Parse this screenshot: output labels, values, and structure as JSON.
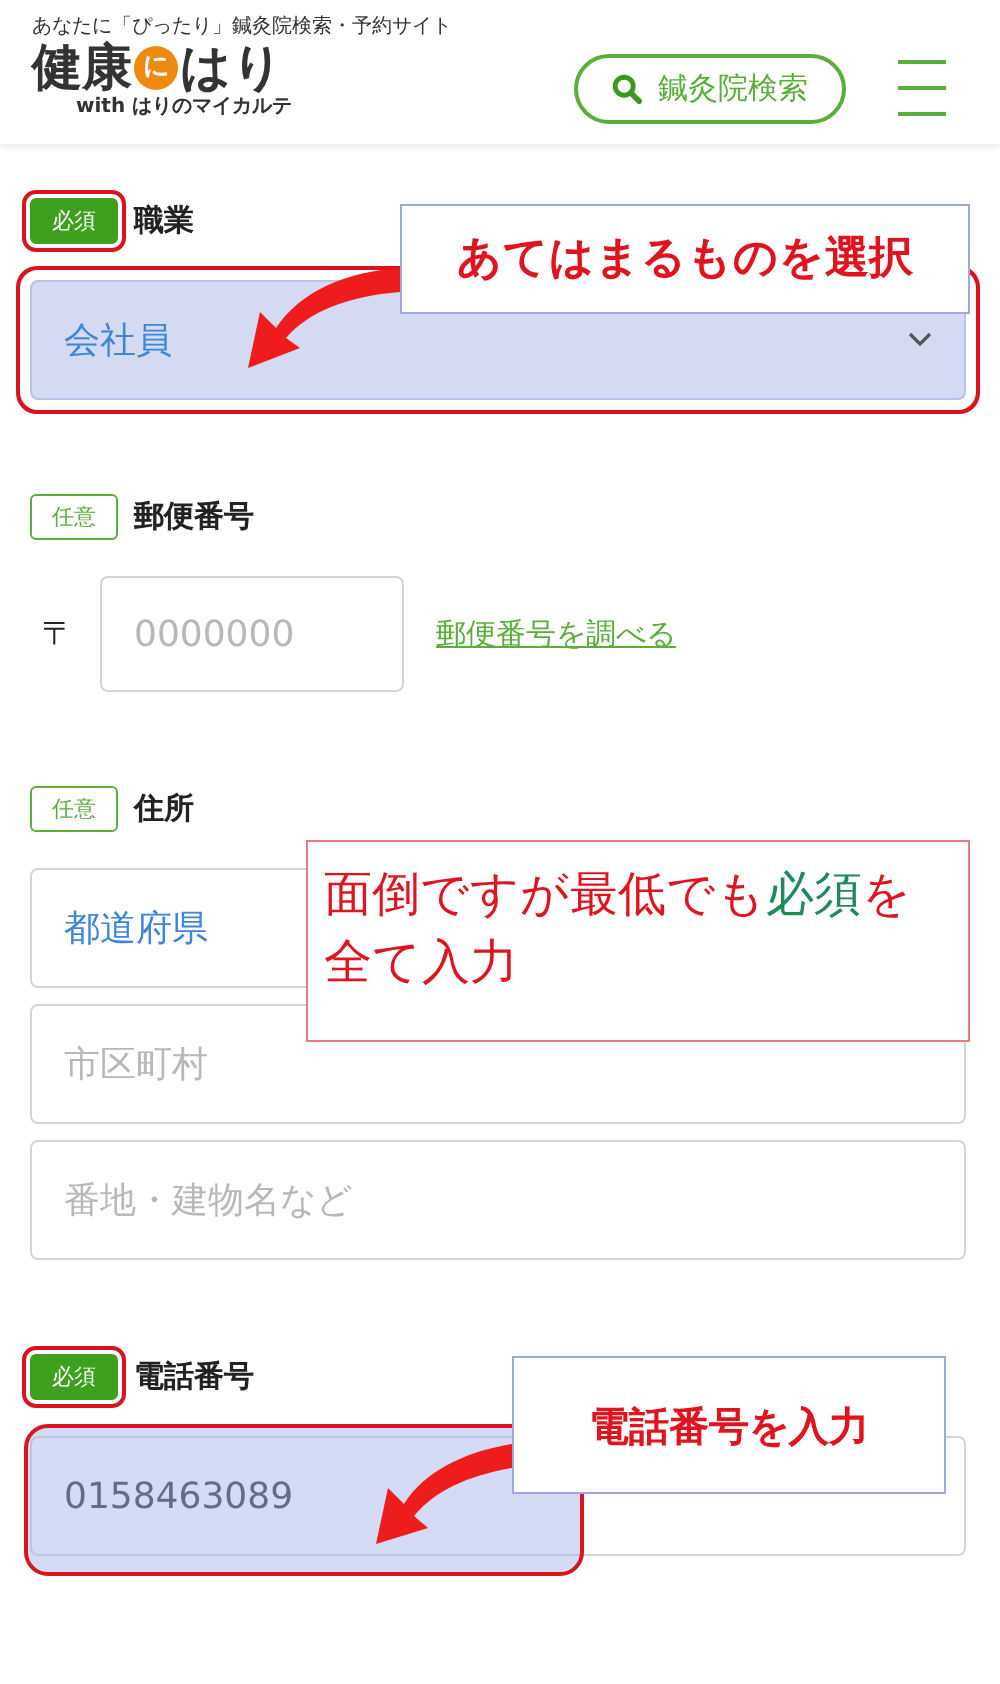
{
  "header": {
    "tagline": "あなたに「ぴったり」鍼灸院検索・予約サイト",
    "logo": {
      "text_1": "健康",
      "mark": "に",
      "text_2": "はり",
      "sub": "with はりのマイカルテ"
    },
    "search_button": "鍼灸院検索"
  },
  "fields": [
    {
      "kind": "select",
      "tag": "必須",
      "required": true,
      "label": "職業",
      "value": "会社員",
      "highlighted": true
    },
    {
      "kind": "postal",
      "tag": "任意",
      "required": false,
      "label": "郵便番号",
      "prefix": "〒",
      "placeholder": "0000000",
      "link": "郵便番号を調べる"
    },
    {
      "kind": "address",
      "tag": "任意",
      "required": false,
      "label": "住所",
      "inputs": [
        {
          "kind": "select",
          "value": "都道府県"
        },
        {
          "kind": "text",
          "placeholder": "市区町村"
        },
        {
          "kind": "text",
          "placeholder": "番地・建物名など"
        }
      ]
    },
    {
      "kind": "text",
      "tag": "必須",
      "required": true,
      "label": "電話番号",
      "value": "0158463089",
      "highlighted": true
    }
  ],
  "annotations": [
    {
      "parts": [
        {
          "text": "あてはまるものを選択",
          "color": "#e0141e"
        }
      ],
      "arrow": true
    },
    {
      "parts": [
        {
          "text": "面倒ですが最低でも",
          "color": "#e0141e"
        },
        {
          "text": "必須",
          "color": "#1f8a5a"
        },
        {
          "text": "を全て入力",
          "color": "#e0141e"
        }
      ],
      "arrow": false
    },
    {
      "parts": [
        {
          "text": "電話番号を入力",
          "color": "#e0141e"
        }
      ],
      "arrow": true
    }
  ]
}
